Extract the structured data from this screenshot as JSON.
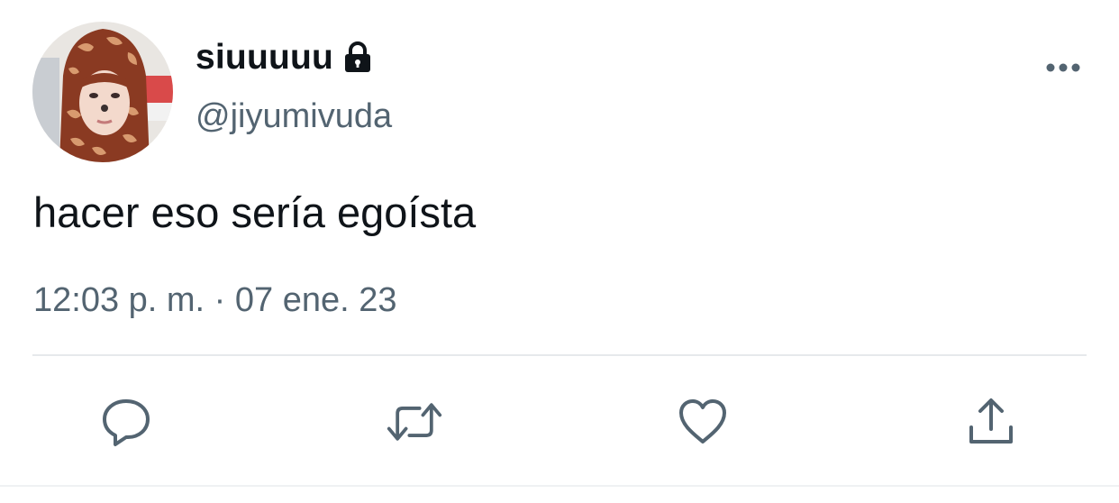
{
  "user": {
    "display_name": "siuuuuu",
    "handle": "@jiyumivuda",
    "protected_icon": "lock-icon",
    "avatar_icon": "avatar-photo"
  },
  "tweet": {
    "text": "hacer eso sería egoísta",
    "timestamp": "12:03 p. m. · 07 ene. 23"
  },
  "actions": {
    "reply": "reply-icon",
    "retweet": "retweet-icon",
    "like": "heart-icon",
    "share": "share-icon",
    "more": "more-icon"
  },
  "colors": {
    "text": "#0f1419",
    "secondary": "#536471",
    "divider": "#e6e9ec"
  }
}
